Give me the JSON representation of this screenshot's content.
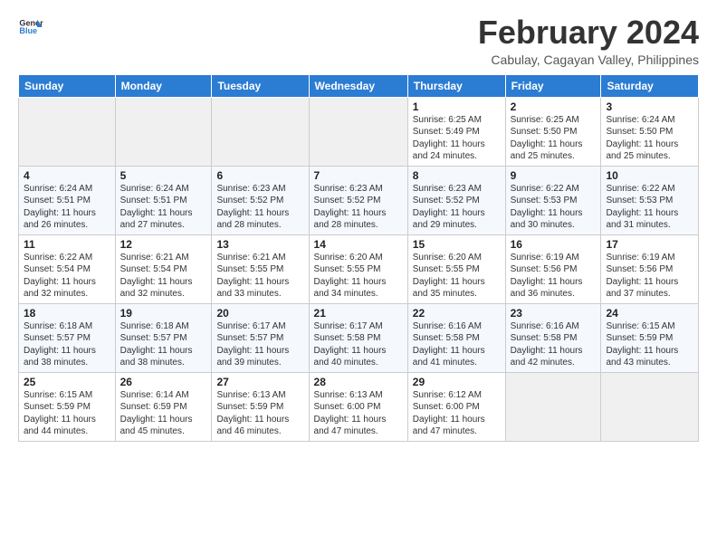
{
  "logo": {
    "line1": "General",
    "line2": "Blue"
  },
  "title": "February 2024",
  "subtitle": "Cabulay, Cagayan Valley, Philippines",
  "weekdays": [
    "Sunday",
    "Monday",
    "Tuesday",
    "Wednesday",
    "Thursday",
    "Friday",
    "Saturday"
  ],
  "weeks": [
    [
      {
        "day": "",
        "info": ""
      },
      {
        "day": "",
        "info": ""
      },
      {
        "day": "",
        "info": ""
      },
      {
        "day": "",
        "info": ""
      },
      {
        "day": "1",
        "info": "Sunrise: 6:25 AM\nSunset: 5:49 PM\nDaylight: 11 hours and 24 minutes."
      },
      {
        "day": "2",
        "info": "Sunrise: 6:25 AM\nSunset: 5:50 PM\nDaylight: 11 hours and 25 minutes."
      },
      {
        "day": "3",
        "info": "Sunrise: 6:24 AM\nSunset: 5:50 PM\nDaylight: 11 hours and 25 minutes."
      }
    ],
    [
      {
        "day": "4",
        "info": "Sunrise: 6:24 AM\nSunset: 5:51 PM\nDaylight: 11 hours and 26 minutes."
      },
      {
        "day": "5",
        "info": "Sunrise: 6:24 AM\nSunset: 5:51 PM\nDaylight: 11 hours and 27 minutes."
      },
      {
        "day": "6",
        "info": "Sunrise: 6:23 AM\nSunset: 5:52 PM\nDaylight: 11 hours and 28 minutes."
      },
      {
        "day": "7",
        "info": "Sunrise: 6:23 AM\nSunset: 5:52 PM\nDaylight: 11 hours and 28 minutes."
      },
      {
        "day": "8",
        "info": "Sunrise: 6:23 AM\nSunset: 5:52 PM\nDaylight: 11 hours and 29 minutes."
      },
      {
        "day": "9",
        "info": "Sunrise: 6:22 AM\nSunset: 5:53 PM\nDaylight: 11 hours and 30 minutes."
      },
      {
        "day": "10",
        "info": "Sunrise: 6:22 AM\nSunset: 5:53 PM\nDaylight: 11 hours and 31 minutes."
      }
    ],
    [
      {
        "day": "11",
        "info": "Sunrise: 6:22 AM\nSunset: 5:54 PM\nDaylight: 11 hours and 32 minutes."
      },
      {
        "day": "12",
        "info": "Sunrise: 6:21 AM\nSunset: 5:54 PM\nDaylight: 11 hours and 32 minutes."
      },
      {
        "day": "13",
        "info": "Sunrise: 6:21 AM\nSunset: 5:55 PM\nDaylight: 11 hours and 33 minutes."
      },
      {
        "day": "14",
        "info": "Sunrise: 6:20 AM\nSunset: 5:55 PM\nDaylight: 11 hours and 34 minutes."
      },
      {
        "day": "15",
        "info": "Sunrise: 6:20 AM\nSunset: 5:55 PM\nDaylight: 11 hours and 35 minutes."
      },
      {
        "day": "16",
        "info": "Sunrise: 6:19 AM\nSunset: 5:56 PM\nDaylight: 11 hours and 36 minutes."
      },
      {
        "day": "17",
        "info": "Sunrise: 6:19 AM\nSunset: 5:56 PM\nDaylight: 11 hours and 37 minutes."
      }
    ],
    [
      {
        "day": "18",
        "info": "Sunrise: 6:18 AM\nSunset: 5:57 PM\nDaylight: 11 hours and 38 minutes."
      },
      {
        "day": "19",
        "info": "Sunrise: 6:18 AM\nSunset: 5:57 PM\nDaylight: 11 hours and 38 minutes."
      },
      {
        "day": "20",
        "info": "Sunrise: 6:17 AM\nSunset: 5:57 PM\nDaylight: 11 hours and 39 minutes."
      },
      {
        "day": "21",
        "info": "Sunrise: 6:17 AM\nSunset: 5:58 PM\nDaylight: 11 hours and 40 minutes."
      },
      {
        "day": "22",
        "info": "Sunrise: 6:16 AM\nSunset: 5:58 PM\nDaylight: 11 hours and 41 minutes."
      },
      {
        "day": "23",
        "info": "Sunrise: 6:16 AM\nSunset: 5:58 PM\nDaylight: 11 hours and 42 minutes."
      },
      {
        "day": "24",
        "info": "Sunrise: 6:15 AM\nSunset: 5:59 PM\nDaylight: 11 hours and 43 minutes."
      }
    ],
    [
      {
        "day": "25",
        "info": "Sunrise: 6:15 AM\nSunset: 5:59 PM\nDaylight: 11 hours and 44 minutes."
      },
      {
        "day": "26",
        "info": "Sunrise: 6:14 AM\nSunset: 6:59 PM\nDaylight: 11 hours and 45 minutes."
      },
      {
        "day": "27",
        "info": "Sunrise: 6:13 AM\nSunset: 5:59 PM\nDaylight: 11 hours and 46 minutes."
      },
      {
        "day": "28",
        "info": "Sunrise: 6:13 AM\nSunset: 6:00 PM\nDaylight: 11 hours and 47 minutes."
      },
      {
        "day": "29",
        "info": "Sunrise: 6:12 AM\nSunset: 6:00 PM\nDaylight: 11 hours and 47 minutes."
      },
      {
        "day": "",
        "info": ""
      },
      {
        "day": "",
        "info": ""
      }
    ]
  ]
}
